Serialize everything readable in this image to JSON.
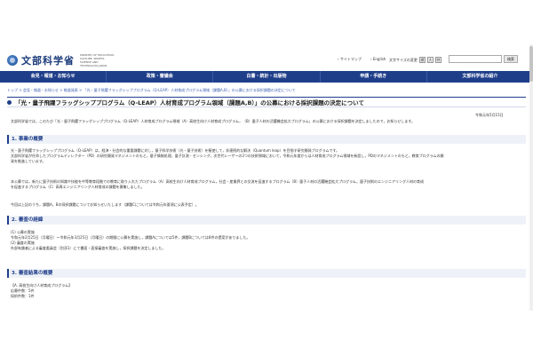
{
  "header": {
    "logo_text": "文部科学省",
    "logo_sub": "MINISTRY OF EDUCATION, CULTURE, SPORTS, SCIENCE AND TECHNOLOGY-JAPAN",
    "sitemap": "› サイトマップ",
    "english": "› English",
    "size_label": "文字サイズの変更",
    "size_buttons": [
      "標",
      "大",
      "特"
    ],
    "search_button": "検索"
  },
  "nav": {
    "items": [
      "会見・報道・お知らせ",
      "政策・審議会",
      "白書・統計・出版物",
      "申請・手続き",
      "文部科学省の紹介"
    ]
  },
  "breadcrumb": "トップ > 会見・報道・お知らせ > 報道発表 > 「光・量子飛躍フラッグシッププログラム（Q-LEAP）人材育成プログラム領域（課題A,B）」の公募における採択課題の決定について",
  "title": "「光・量子飛躍フラッグシッププログラム（Q-LEAP）人材育成プログラム領域（課題A,B）」の公募における採択課題の決定について",
  "date": "令和元年5月15日",
  "intro": "文部科学省では，このたび「光・量子飛躍フラッグシッププログラム（Q-LEAP）人材育成プログラム領域（A）高校生向け人材育成プログラム，（B）量子人材の活躍機会拡大プログラム」の公募における採択課題を決定しましたので，お知らせします。",
  "sections": [
    {
      "heading": "1. 事業の概要",
      "lines": [
        "光・量子飛躍フラッグシッププログラム（Q-LEAP）は，経済・社会的な重要課題に対し，量子科学技術（光・量子技術）を駆使して，非連続的な解決（Quantum leap）を目指す研究開発プログラムです。",
        "文部科学省が任命したプログラムディレクター（PD）の研究開発マネジメントのもと，量子情報処理，量子計測・センシング，次世代レーザーの3つの技術領域において，令和元年度からは人材育成プログラム領域を新設し，PDのマネジメントのもと，教育プログラムの開",
        "発を推進しています。",
        "",
        "本公募では，新たに量子技術の知識や技能を中等教育段階での教育に取り入れたプログラム（A）高校生向け人材育成プログラム，社会・産業界との交流を促進するプログラム（B）量子人材の活躍機会拡大プログラム，量子技術のエンジニアリング人材の育成",
        "を促進するプログラム（C）高専エンジニアリング人材育成の課題を募集しました。",
        "",
        "今回は上記のうち，課題A，Bの採択課題についてお知らせいたします（課題Cについては令和元年夏頃に公表予定）。"
      ]
    },
    {
      "heading": "2. 審査の経緯",
      "lines": [
        "(1) 公募の実施",
        "令和元年2月25日（月曜日）～令和元年3月25日（月曜日）の期間に公募を実施し，課題Aについては5件，課題Bについては8件の提案がありました。",
        "(2) 審査の実施",
        "外部有識者による審査委員会（別添1）にて書面・面接審査を実施し，採択課題を決定しました。",
        ""
      ]
    },
    {
      "heading": "3. 審査結果の概要",
      "lines": [
        "【A. 高校生向け人材育成プログラム】",
        "応募件数：5件",
        "採択件数：1件"
      ]
    }
  ]
}
